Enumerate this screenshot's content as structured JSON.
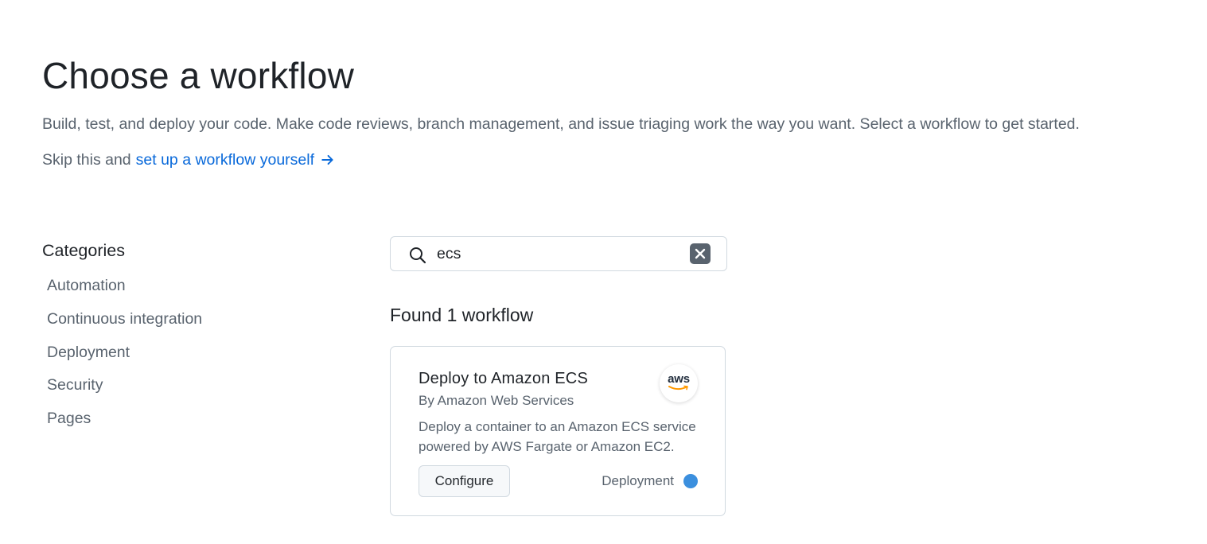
{
  "header": {
    "title": "Choose a workflow",
    "subtitle": "Build, test, and deploy your code. Make code reviews, branch management, and issue triaging work the way you want. Select a workflow to get started.",
    "skip_prefix": "Skip this and",
    "skip_link": "set up a workflow yourself"
  },
  "sidebar": {
    "heading": "Categories",
    "items": [
      {
        "label": "Automation"
      },
      {
        "label": "Continuous integration"
      },
      {
        "label": "Deployment"
      },
      {
        "label": "Security"
      },
      {
        "label": "Pages"
      }
    ]
  },
  "search": {
    "value": "ecs",
    "placeholder": "",
    "icon": "search-icon",
    "clear_icon": "close-icon"
  },
  "results": {
    "found_text": "Found 1 workflow",
    "cards": [
      {
        "title": "Deploy to Amazon ECS",
        "author": "By Amazon Web Services",
        "description": "Deploy a container to an Amazon ECS service powered by AWS Fargate or Amazon EC2.",
        "logo_text": "aws",
        "configure_label": "Configure",
        "category": "Deployment",
        "category_color": "#3b8fde"
      }
    ]
  },
  "colors": {
    "link": "#0969da",
    "text_primary": "#1f2328",
    "text_muted": "#59636e",
    "aws_orange": "#ff9900"
  }
}
